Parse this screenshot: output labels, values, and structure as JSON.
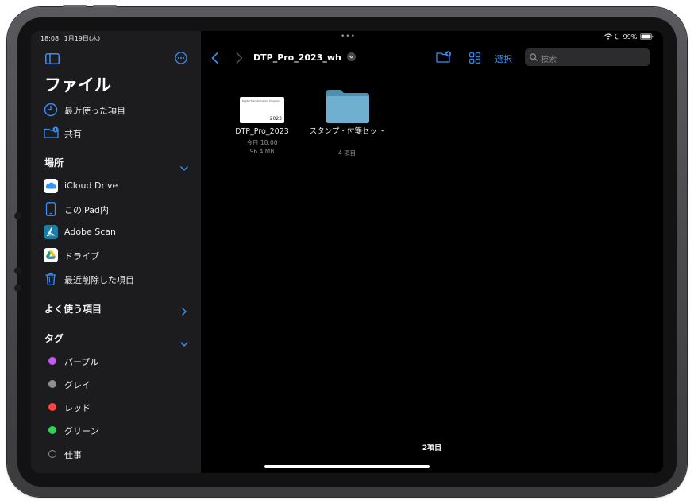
{
  "status": {
    "time": "18:08",
    "date": "1月19日(木)",
    "battery": "99%",
    "multitask_dots": "•••"
  },
  "sidebar": {
    "title": "ファイル",
    "top_items": [
      {
        "label": "最近使った項目",
        "icon": "clock-icon"
      },
      {
        "label": "共有",
        "icon": "shared-folder-icon"
      }
    ],
    "locations": {
      "title": "場所",
      "items": [
        {
          "label": "iCloud Drive",
          "icon": "icloud-icon"
        },
        {
          "label": "このiPad内",
          "icon": "ipad-icon"
        },
        {
          "label": "Adobe Scan",
          "icon": "adobe-scan-icon"
        },
        {
          "label": "ドライブ",
          "icon": "google-drive-icon"
        },
        {
          "label": "最近削除した項目",
          "icon": "trash-icon"
        }
      ]
    },
    "favorites": {
      "title": "よく使う項目"
    },
    "tags": {
      "title": "タグ",
      "items": [
        {
          "label": "パープル",
          "color": "#bf5af2"
        },
        {
          "label": "グレイ",
          "color": "#8e8e93"
        },
        {
          "label": "レッド",
          "color": "#ff453a"
        },
        {
          "label": "グリーン",
          "color": "#30d158"
        },
        {
          "label": "仕事",
          "color": ""
        }
      ]
    }
  },
  "toolbar": {
    "path_title": "DTP_Pro_2023_wh",
    "select_label": "選択",
    "search_placeholder": "検索"
  },
  "files": [
    {
      "name": "DTP_Pro_2023",
      "date": "今日 18:00",
      "size": "96.4 MB",
      "thumb_text": "Digital Transformation Program",
      "thumb_year": "2023"
    },
    {
      "name": "スタンプ・付箋セット",
      "count": "4 項目"
    }
  ],
  "footer": {
    "item_count": "2項目"
  },
  "colors": {
    "accent": "#3a8ef6",
    "sidebar_bg": "#1c1c1e",
    "main_bg": "#000000",
    "folder": "#6fb0d0"
  }
}
